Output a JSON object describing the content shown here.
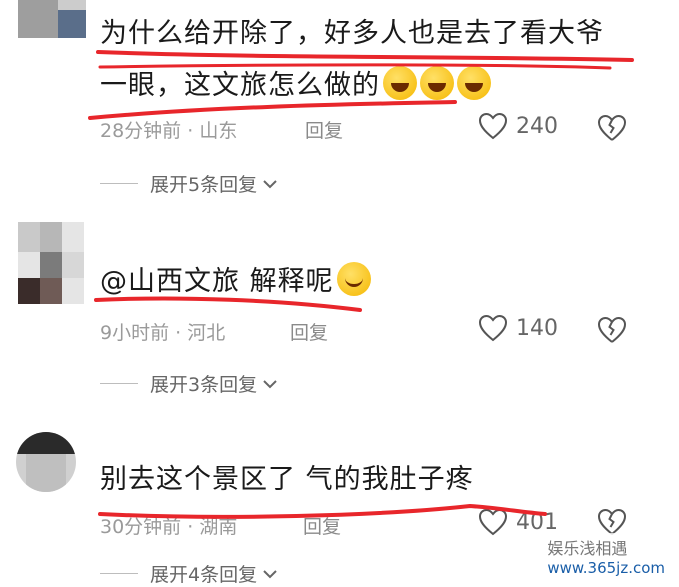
{
  "comments": [
    {
      "text_line1": "为什么给开除了，好多人也是去了看大爷",
      "text_line2": "一眼，这文旅怎么做的",
      "time": "28分钟前",
      "location": "山东",
      "reply_label": "回复",
      "likes": "240",
      "expand_label": "展开5条回复"
    },
    {
      "text_line1": "@山西文旅 解释呢",
      "time": "9小时前",
      "location": "河北",
      "reply_label": "回复",
      "likes": "140",
      "expand_label": "展开3条回复"
    },
    {
      "text_line1": "别去这个景区了 气的我肚子疼",
      "time": "30分钟前",
      "location": "湖南",
      "reply_label": "回复",
      "likes": "401",
      "expand_label": "展开4条回复"
    }
  ],
  "separator": "·",
  "watermark": {
    "brand": "娱乐浅相遇",
    "site": "www.365jz.com"
  },
  "colors": {
    "annotation_red": "#e8262b",
    "meta_gray": "#9a9a9a"
  },
  "icons": [
    "heart-icon",
    "broken-heart-icon",
    "chevron-down-icon",
    "emoji-laugh-icon",
    "emoji-smile-icon"
  ]
}
